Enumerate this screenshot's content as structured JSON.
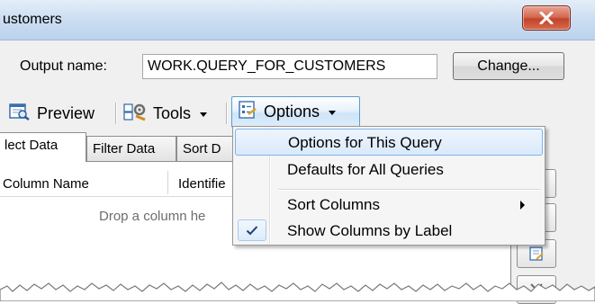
{
  "window": {
    "title": "ustomers",
    "close_icon": "close-icon"
  },
  "output": {
    "label": "Output name:",
    "value": "WORK.QUERY_FOR_CUSTOMERS",
    "change_label": "Change..."
  },
  "toolbar": {
    "preview_label": "Preview",
    "tools_label": "Tools",
    "options_label": "Options"
  },
  "tabs": [
    {
      "label": "lect Data",
      "active": true
    },
    {
      "label": "Filter Data",
      "active": false
    },
    {
      "label": "Sort D",
      "active": false
    }
  ],
  "columns": {
    "name_header": "Column Name",
    "identifier_header": "Identifie",
    "drop_hint": "Drop a column he"
  },
  "options_menu": {
    "items": [
      {
        "label": "Options for This Query",
        "highlighted": true
      },
      {
        "label": "Defaults for All Queries"
      },
      {
        "label": "Sort Columns",
        "has_submenu": true
      },
      {
        "label": "Show Columns by Label",
        "checked": true
      }
    ]
  },
  "colors": {
    "titlebar": "#c9dcf1",
    "close_button": "#c2432b",
    "menu_highlight": "#d9e9fb",
    "dialog_bg": "#f0f0f0"
  }
}
